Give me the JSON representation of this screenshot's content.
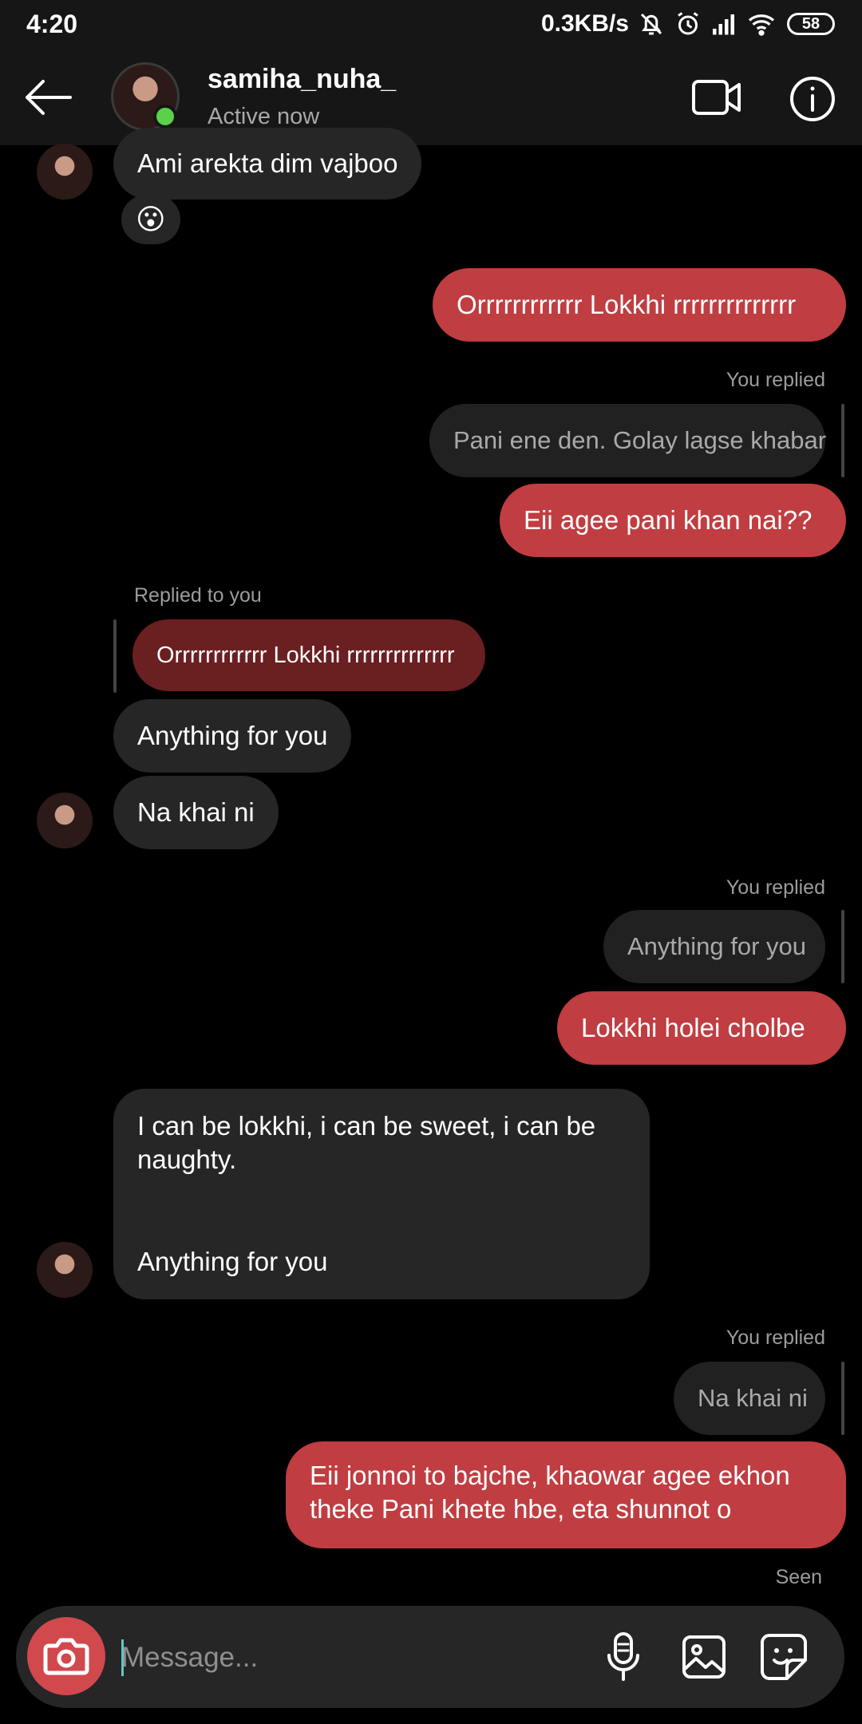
{
  "status_bar": {
    "time": "4:20",
    "net_speed": "0.3KB/s",
    "battery": "58"
  },
  "header": {
    "username": "samiha_nuha_",
    "status": "Active now"
  },
  "messages": {
    "m1": "Ami arekta dim vajboo",
    "m1_reaction": "😮",
    "m2": "Orrrrrrrrrrrr Lokkhi rrrrrrrrrrrrrr",
    "r1_label": "You replied",
    "r1_quote": "Pani ene den. Golay lagse khabar",
    "m3": "Eii agee pani khan nai??",
    "r2_label": "Replied to you",
    "r2_quote": "Orrrrrrrrrrrr Lokkhi rrrrrrrrrrrrrr",
    "m4": "Anything for you",
    "m5": "Na khai ni",
    "r3_label": "You replied",
    "r3_quote": "Anything for you",
    "m6": "Lokkhi holei cholbe",
    "m7_line1": "I can be lokkhi, i can be sweet, i can be",
    "m7_line2": "naughty.",
    "m7_line3": "Anything for you",
    "r4_label": "You replied",
    "r4_quote": "Na khai ni",
    "m8_line1": "Eii jonnoi to bajche, khaowar agee ekhon",
    "m8_line2": "theke Pani khete hbe, eta shunnot o",
    "seen": "Seen"
  },
  "composer": {
    "placeholder": "Message..."
  },
  "icons": {
    "back": "back-arrow-icon",
    "video": "video-camera-icon",
    "info": "info-icon",
    "camera": "camera-icon",
    "mic": "microphone-icon",
    "gallery": "gallery-icon",
    "sticker": "sticker-icon"
  },
  "colors": {
    "outgoing_bubble": "#c03d41",
    "incoming_bubble": "#262626",
    "online": "#5bd14b",
    "camera_button": "#d1484d"
  }
}
